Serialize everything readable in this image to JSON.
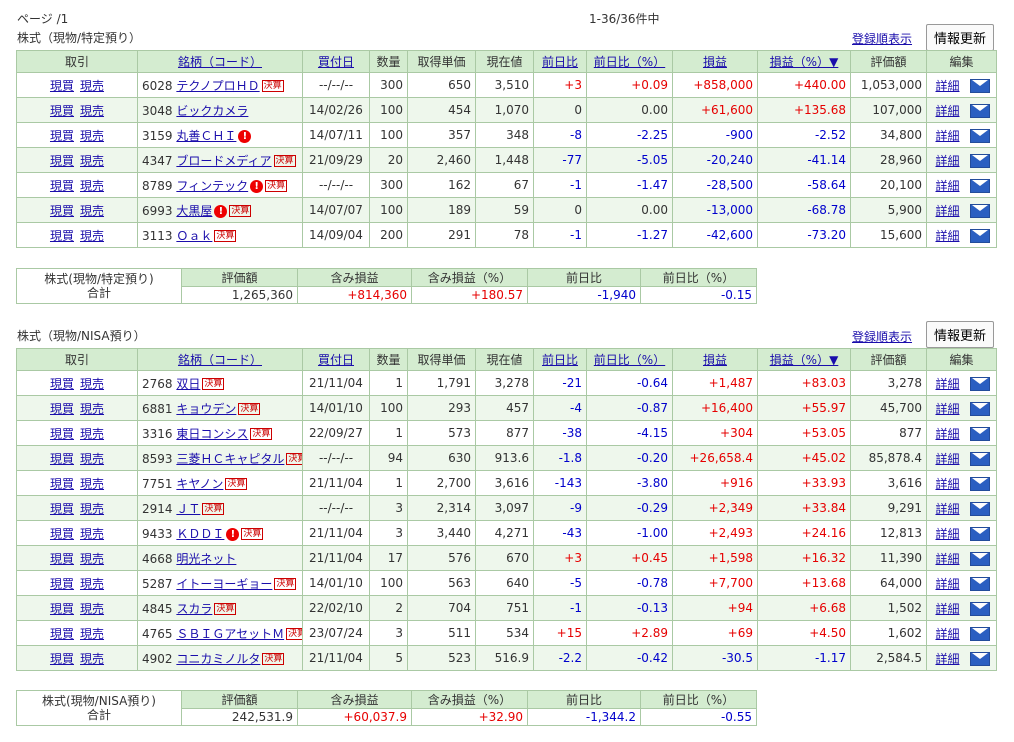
{
  "page_label": "ページ /1",
  "page_count": "1-36/36件中",
  "sections": [
    {
      "title": "株式（現物/特定預り）",
      "reg_link": "登録順表示",
      "update_btn": "情報更新",
      "headers": [
        "取引",
        "銘柄（コード）",
        "買付日",
        "数量",
        "取得単価",
        "現在値",
        "前日比",
        "前日比（%）",
        "損益",
        "損益（%）▼",
        "評価額",
        "編集"
      ],
      "rows": [
        {
          "code": "6028",
          "name": "テクノプロＨＤ",
          "alert": false,
          "kessan": true,
          "date": "--/--/--",
          "qty": "300",
          "cost": "650",
          "price": "3,510",
          "chg": "+3",
          "chgp": "+0.09",
          "pl": "+858,000",
          "plp": "+440.00",
          "value": "1,053,000"
        },
        {
          "code": "3048",
          "name": "ビックカメラ",
          "alert": false,
          "kessan": false,
          "date": "14/02/26",
          "qty": "100",
          "cost": "454",
          "price": "1,070",
          "chg": "0",
          "chgp": "0.00",
          "pl": "+61,600",
          "plp": "+135.68",
          "value": "107,000"
        },
        {
          "code": "3159",
          "name": "丸善ＣＨＩ",
          "alert": true,
          "kessan": false,
          "date": "14/07/11",
          "qty": "100",
          "cost": "357",
          "price": "348",
          "chg": "-8",
          "chgp": "-2.25",
          "pl": "-900",
          "plp": "-2.52",
          "value": "34,800"
        },
        {
          "code": "4347",
          "name": "ブロードメディア",
          "alert": false,
          "kessan": true,
          "date": "21/09/29",
          "qty": "20",
          "cost": "2,460",
          "price": "1,448",
          "chg": "-77",
          "chgp": "-5.05",
          "pl": "-20,240",
          "plp": "-41.14",
          "value": "28,960"
        },
        {
          "code": "8789",
          "name": "フィンテック",
          "alert": true,
          "kessan": true,
          "date": "--/--/--",
          "qty": "300",
          "cost": "162",
          "price": "67",
          "chg": "-1",
          "chgp": "-1.47",
          "pl": "-28,500",
          "plp": "-58.64",
          "value": "20,100"
        },
        {
          "code": "6993",
          "name": "大黒屋",
          "alert": true,
          "kessan": true,
          "date": "14/07/07",
          "qty": "100",
          "cost": "189",
          "price": "59",
          "chg": "0",
          "chgp": "0.00",
          "pl": "-13,000",
          "plp": "-68.78",
          "value": "5,900"
        },
        {
          "code": "3113",
          "name": "Ｏａｋ",
          "alert": false,
          "kessan": true,
          "date": "14/09/04",
          "qty": "200",
          "cost": "291",
          "price": "78",
          "chg": "-1",
          "chgp": "-1.27",
          "pl": "-42,600",
          "plp": "-73.20",
          "value": "15,600"
        }
      ],
      "summary": {
        "label1": "株式(現物/特定預り)",
        "label2": "合計",
        "headers": [
          "評価額",
          "含み損益",
          "含み損益（%）",
          "前日比",
          "前日比（%）"
        ],
        "values": [
          "1,265,360",
          "+814,360",
          "+180.57",
          "-1,940",
          "-0.15"
        ]
      }
    },
    {
      "title": "株式（現物/NISA預り）",
      "reg_link": "登録順表示",
      "update_btn": "情報更新",
      "headers": [
        "取引",
        "銘柄（コード）",
        "買付日",
        "数量",
        "取得単価",
        "現在値",
        "前日比",
        "前日比（%）",
        "損益",
        "損益（%）▼",
        "評価額",
        "編集"
      ],
      "rows": [
        {
          "code": "2768",
          "name": "双日",
          "alert": false,
          "kessan": true,
          "date": "21/11/04",
          "qty": "1",
          "cost": "1,791",
          "price": "3,278",
          "chg": "-21",
          "chgp": "-0.64",
          "pl": "+1,487",
          "plp": "+83.03",
          "value": "3,278"
        },
        {
          "code": "6881",
          "name": "キョウデン",
          "alert": false,
          "kessan": true,
          "date": "14/01/10",
          "qty": "100",
          "cost": "293",
          "price": "457",
          "chg": "-4",
          "chgp": "-0.87",
          "pl": "+16,400",
          "plp": "+55.97",
          "value": "45,700"
        },
        {
          "code": "3316",
          "name": "東日コンシス",
          "alert": false,
          "kessan": true,
          "date": "22/09/27",
          "qty": "1",
          "cost": "573",
          "price": "877",
          "chg": "-38",
          "chgp": "-4.15",
          "pl": "+304",
          "plp": "+53.05",
          "value": "877"
        },
        {
          "code": "8593",
          "name": "三菱ＨＣキャピタル",
          "alert": false,
          "kessan": true,
          "date": "--/--/--",
          "qty": "94",
          "cost": "630",
          "price": "913.6",
          "chg": "-1.8",
          "chgp": "-0.20",
          "pl": "+26,658.4",
          "plp": "+45.02",
          "value": "85,878.4"
        },
        {
          "code": "7751",
          "name": "キヤノン",
          "alert": false,
          "kessan": true,
          "date": "21/11/04",
          "qty": "1",
          "cost": "2,700",
          "price": "3,616",
          "chg": "-143",
          "chgp": "-3.80",
          "pl": "+916",
          "plp": "+33.93",
          "value": "3,616"
        },
        {
          "code": "2914",
          "name": "ＪＴ",
          "alert": false,
          "kessan": true,
          "date": "--/--/--",
          "qty": "3",
          "cost": "2,314",
          "price": "3,097",
          "chg": "-9",
          "chgp": "-0.29",
          "pl": "+2,349",
          "plp": "+33.84",
          "value": "9,291"
        },
        {
          "code": "9433",
          "name": "ＫＤＤＩ",
          "alert": true,
          "kessan": true,
          "date": "21/11/04",
          "qty": "3",
          "cost": "3,440",
          "price": "4,271",
          "chg": "-43",
          "chgp": "-1.00",
          "pl": "+2,493",
          "plp": "+24.16",
          "value": "12,813"
        },
        {
          "code": "4668",
          "name": "明光ネット",
          "alert": false,
          "kessan": false,
          "date": "21/11/04",
          "qty": "17",
          "cost": "576",
          "price": "670",
          "chg": "+3",
          "chgp": "+0.45",
          "pl": "+1,598",
          "plp": "+16.32",
          "value": "11,390"
        },
        {
          "code": "5287",
          "name": "イトーヨーギョー",
          "alert": false,
          "kessan": true,
          "date": "14/01/10",
          "qty": "100",
          "cost": "563",
          "price": "640",
          "chg": "-5",
          "chgp": "-0.78",
          "pl": "+7,700",
          "plp": "+13.68",
          "value": "64,000"
        },
        {
          "code": "4845",
          "name": "スカラ",
          "alert": false,
          "kessan": true,
          "date": "22/02/10",
          "qty": "2",
          "cost": "704",
          "price": "751",
          "chg": "-1",
          "chgp": "-0.13",
          "pl": "+94",
          "plp": "+6.68",
          "value": "1,502"
        },
        {
          "code": "4765",
          "name": "ＳＢＩＧアセットＭ",
          "alert": false,
          "kessan": true,
          "date": "23/07/24",
          "qty": "3",
          "cost": "511",
          "price": "534",
          "chg": "+15",
          "chgp": "+2.89",
          "pl": "+69",
          "plp": "+4.50",
          "value": "1,602"
        },
        {
          "code": "4902",
          "name": "コニカミノルタ",
          "alert": false,
          "kessan": true,
          "date": "21/11/04",
          "qty": "5",
          "cost": "523",
          "price": "516.9",
          "chg": "-2.2",
          "chgp": "-0.42",
          "pl": "-30.5",
          "plp": "-1.17",
          "value": "2,584.5"
        }
      ],
      "summary": {
        "label1": "株式(現物/NISA預り)",
        "label2": "合計",
        "headers": [
          "評価額",
          "含み損益",
          "含み損益（%）",
          "前日比",
          "前日比（%）"
        ],
        "values": [
          "242,531.9",
          "+60,037.9",
          "+32.90",
          "-1,344.2",
          "-0.55"
        ]
      }
    }
  ],
  "labels": {
    "buy": "現買",
    "sell": "現売",
    "detail": "詳細",
    "kessan": "決算",
    "alert": "!"
  },
  "colors": {
    "header_bg": "#d4ecd0",
    "row_alt": "#eef7ec",
    "border": "#aac9a4",
    "positive": "#e60000",
    "negative": "#0000cc",
    "link": "#1a0dab"
  }
}
